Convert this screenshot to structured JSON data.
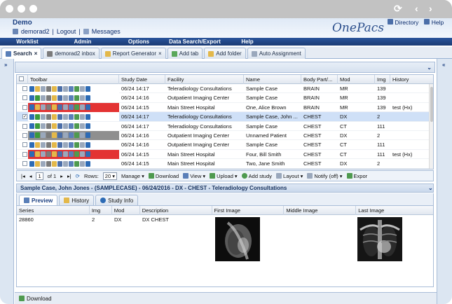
{
  "header": {
    "title": "Demo",
    "user": "demorad2",
    "logout": "Logout",
    "messages": "Messages",
    "logo": "OnePacs",
    "directory": "Directory",
    "help": "Help",
    "separator": "|"
  },
  "menu": [
    {
      "label": "Worklist"
    },
    {
      "label": "Admin"
    },
    {
      "label": "Options"
    },
    {
      "label": "Data Search/Export"
    },
    {
      "label": "Help"
    }
  ],
  "tabs": [
    {
      "label": "Search",
      "active": true
    },
    {
      "label": "demorad2 inbox"
    },
    {
      "label": "Report Generator"
    },
    {
      "label": "Add tab"
    },
    {
      "label": "Add folder"
    },
    {
      "label": "Auto Assignment"
    }
  ],
  "grid": {
    "headers": [
      "Toolbar",
      "Study Date",
      "Facility",
      "Name",
      "Body Part/...",
      "Mod",
      "Img",
      "History"
    ],
    "rows": [
      {
        "date": "06/24 14:17",
        "facility": "Teleradiology Consultations",
        "name": "Sample Case",
        "body": "BRAIN",
        "mod": "MR",
        "img": "139",
        "history": "",
        "color": "#ffffff",
        "check": false
      },
      {
        "date": "06/24 14:16",
        "facility": "Outpatient Imaging Center",
        "name": "Sample Case",
        "body": "BRAIN",
        "mod": "MR",
        "img": "139",
        "history": "",
        "color": "#ffffff",
        "check": true
      },
      {
        "date": "06/24 14:15",
        "facility": "Main Street Hospital",
        "name": "One, Alice Brown",
        "body": "BRAIN",
        "mod": "MR",
        "img": "139",
        "history": "test (Hx)",
        "color": "#e33333",
        "check": false
      },
      {
        "date": "06/24 14:17",
        "facility": "Teleradiology Consultations",
        "name": "Sample Case, John ...",
        "body": "CHEST",
        "mod": "DX",
        "img": "2",
        "history": "",
        "color": "#ffffff",
        "check": true,
        "selected": true
      },
      {
        "date": "06/24 14:17",
        "facility": "Teleradiology Consultations",
        "name": "Sample Case",
        "body": "CHEST",
        "mod": "CT",
        "img": "111",
        "history": "",
        "color": "#ffffff",
        "check": true
      },
      {
        "date": "06/24 14:16",
        "facility": "Outpatient Imaging Center",
        "name": "Unnamed Patient",
        "body": "CHEST",
        "mod": "DX",
        "img": "2",
        "history": "",
        "color": "#8f8f8f",
        "check": true
      },
      {
        "date": "06/24 14:16",
        "facility": "Outpatient Imaging Center",
        "name": "Sample Case",
        "body": "CHEST",
        "mod": "CT",
        "img": "111",
        "history": "",
        "color": "#ffffff",
        "check": false
      },
      {
        "date": "06/24 14:15",
        "facility": "Main Street Hospital",
        "name": "Four, Bill Smith",
        "body": "CHEST",
        "mod": "CT",
        "img": "111",
        "history": "test (Hx)",
        "color": "#e33333",
        "check": false
      },
      {
        "date": "06/24 14:15",
        "facility": "Main Street Hospital",
        "name": "Two, Jane Smith",
        "body": "CHEST",
        "mod": "DX",
        "img": "2",
        "history": "",
        "color": "#ffffff",
        "check": false
      }
    ]
  },
  "pager": {
    "page": "1",
    "of": "of 1",
    "rows_label": "Rows:",
    "rows_value": "20",
    "manage": "Manage",
    "download": "Download",
    "view": "View",
    "upload": "Upload",
    "add_study": "Add study",
    "layout": "Layout",
    "notify": "Notify (off)",
    "export": "Expor"
  },
  "detail": {
    "title": "Sample Case, John Jones - (SAMPLECASE) - 06/24/2016 - DX - CHEST - Teleradiology Consultations",
    "tabs": [
      {
        "label": "Preview",
        "active": true
      },
      {
        "label": "History"
      },
      {
        "label": "Study Info"
      }
    ],
    "headers": [
      "Series",
      "Img",
      "Mod",
      "Description",
      "First Image",
      "Middle Image",
      "Last Image"
    ],
    "row": {
      "series": "28860",
      "img": "2",
      "mod": "DX",
      "description": "DX CHEST"
    }
  },
  "bottom": {
    "download": "Download"
  },
  "icons": [
    "refresh-icon",
    "back-icon",
    "forward-icon",
    "close-icon",
    "search-icon",
    "inbox-icon",
    "folder-icon",
    "add-icon",
    "gear-icon",
    "download-icon",
    "upload-icon",
    "user-icon",
    "messages-icon",
    "directory-icon",
    "help-icon"
  ],
  "colors": {
    "accent": "#1b3b74",
    "urgent": "#e33333",
    "selected": "#cfe0f7"
  }
}
